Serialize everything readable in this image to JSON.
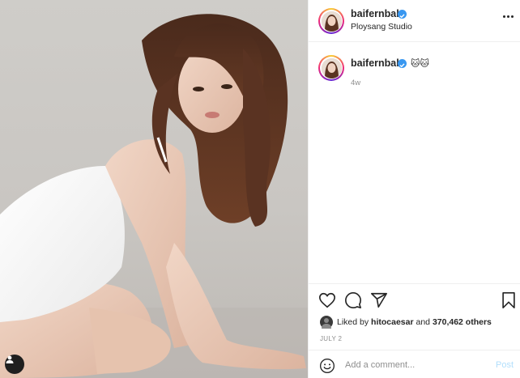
{
  "post": {
    "image_alt": "Woman in white dress kneeling on studio floor",
    "username": "baifernbah",
    "location": "Ploysang Studio",
    "caption": {
      "username": "baifernbah",
      "emojis": "🐱🐱",
      "time_ago": "4w"
    },
    "likes": {
      "prefix": "Liked by",
      "user": "hitocaesar",
      "and": "and",
      "count": "370,462 others"
    },
    "date": "JULY 2",
    "comment": {
      "placeholder": "Add a comment...",
      "post_label": "Post"
    }
  },
  "icons": {
    "tag": "user-tag-icon",
    "verified": "verified-badge-icon",
    "more": "more-options-icon",
    "like": "heart-icon",
    "comment": "comment-icon",
    "share": "paper-plane-icon",
    "save": "bookmark-icon",
    "emoji": "emoji-icon"
  },
  "colors": {
    "verified": "#3897f0",
    "secondary_text": "#8e8e8e",
    "post_disabled": "#b2dffc",
    "border": "#efefef"
  }
}
